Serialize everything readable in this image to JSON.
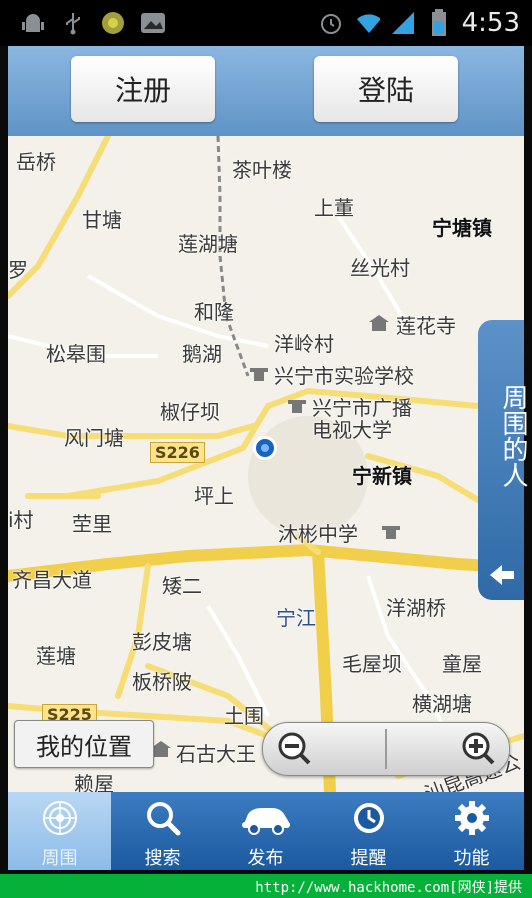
{
  "status_bar": {
    "time": "4:53",
    "icons": [
      "android-debug-icon",
      "usb-icon",
      "notification-app-icon",
      "photo-icon",
      "alarm-icon",
      "wifi-icon",
      "signal-icon",
      "battery-icon"
    ]
  },
  "header": {
    "register_label": "注册",
    "login_label": "登陆"
  },
  "map": {
    "places": [
      {
        "id": "yueqiao",
        "text": "岳桥"
      },
      {
        "id": "chayelou",
        "text": "茶叶楼"
      },
      {
        "id": "gantang",
        "text": "甘塘"
      },
      {
        "id": "shangdong",
        "text": "上董"
      },
      {
        "id": "ningtangzhen",
        "text": "宁塘镇"
      },
      {
        "id": "lianhutang",
        "text": "莲湖塘"
      },
      {
        "id": "luo",
        "text": "罗"
      },
      {
        "id": "siguangcun",
        "text": "丝光村"
      },
      {
        "id": "helong",
        "text": "和隆"
      },
      {
        "id": "lianhuasi",
        "text": "莲花寺"
      },
      {
        "id": "yanglingcun",
        "text": "洋岭村"
      },
      {
        "id": "songgaowei",
        "text": "松皋围"
      },
      {
        "id": "ehu",
        "text": "鹅湖"
      },
      {
        "id": "shiyan",
        "text": "兴宁市实验学校"
      },
      {
        "id": "jiaoziba",
        "text": "椒仔坝"
      },
      {
        "id": "guangbo",
        "text": "兴宁市广播"
      },
      {
        "id": "dianshi",
        "text": "电视大学"
      },
      {
        "id": "fengmentang",
        "text": "风门塘"
      },
      {
        "id": "ningxinzhen",
        "text": "宁新镇"
      },
      {
        "id": "pingshang",
        "text": "坪上"
      },
      {
        "id": "cun",
        "text": "i村"
      },
      {
        "id": "wali",
        "text": "茔里"
      },
      {
        "id": "mubinzhongxue",
        "text": "沐彬中学"
      },
      {
        "id": "qichangdadao",
        "text": "齐昌大道"
      },
      {
        "id": "aier",
        "text": "矮二"
      },
      {
        "id": "ningjiang",
        "text": "宁江"
      },
      {
        "id": "yanghuqiao",
        "text": "洋湖桥"
      },
      {
        "id": "liantang",
        "text": "莲塘"
      },
      {
        "id": "pengpitang",
        "text": "彭皮塘"
      },
      {
        "id": "maowuba",
        "text": "毛屋坝"
      },
      {
        "id": "tongwu",
        "text": "童屋"
      },
      {
        "id": "banqiaopo",
        "text": "板桥陂"
      },
      {
        "id": "henghutang",
        "text": "横湖塘"
      },
      {
        "id": "tuwei",
        "text": "土围"
      },
      {
        "id": "shigudawang",
        "text": "石古大王"
      },
      {
        "id": "laiwu",
        "text": "赖屋"
      },
      {
        "id": "shanling",
        "text": "汕昆高速公"
      }
    ],
    "road_tags": [
      {
        "id": "s226",
        "text": "S226"
      },
      {
        "id": "s225",
        "text": "S225"
      }
    ]
  },
  "side_panel": {
    "label": "周围的人"
  },
  "my_location_label": "我的位置",
  "tabs": [
    {
      "label": "周围",
      "icon": "radar-icon",
      "active": true
    },
    {
      "label": "搜索",
      "icon": "search-icon",
      "active": false
    },
    {
      "label": "发布",
      "icon": "car-icon",
      "active": false
    },
    {
      "label": "提醒",
      "icon": "clock-icon",
      "active": false
    },
    {
      "label": "功能",
      "icon": "gear-icon",
      "active": false
    }
  ],
  "footer": {
    "text": "http://www.hackhome.com[网侠]提供"
  }
}
